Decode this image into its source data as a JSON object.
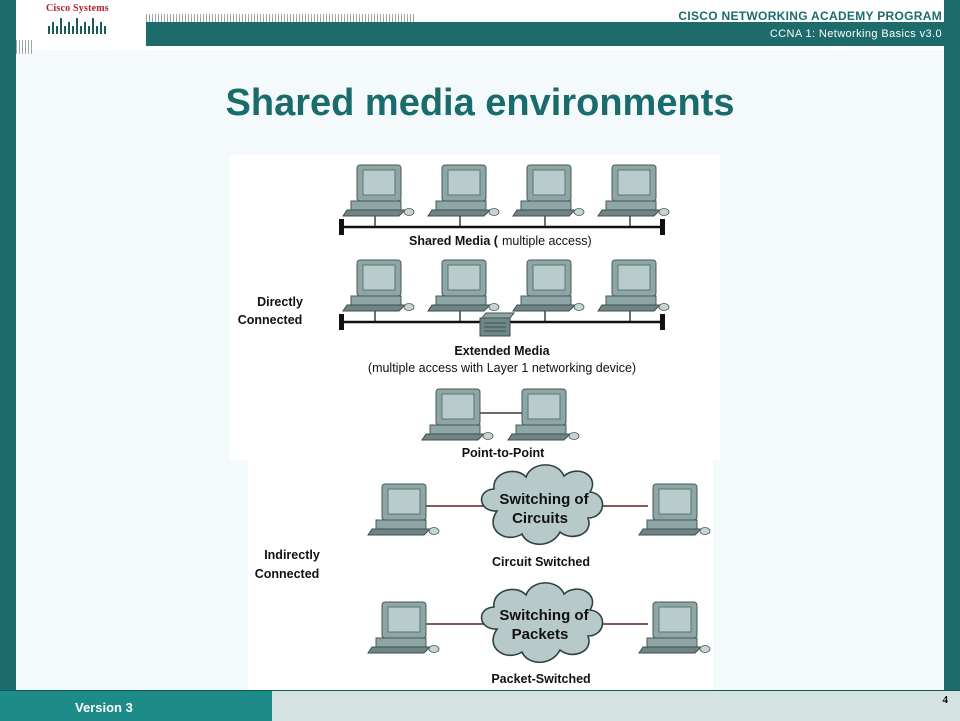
{
  "header": {
    "logo_text": "Cisco Systems",
    "program": "CISCO NETWORKING ACADEMY PROGRAM",
    "course": "CCNA 1: Networking Basics v3.0"
  },
  "slide": {
    "title": "Shared media environments"
  },
  "diagram": {
    "groups": {
      "direct": [
        "Directly",
        "Connected"
      ],
      "indirect": [
        "Indirectly",
        "Connected"
      ]
    },
    "shared_media": {
      "label_bold": "Shared Media (",
      "label_rest": "multiple access)"
    },
    "extended_media": {
      "label": "Extended Media",
      "sublabel": "(multiple access with Layer 1 networking device)"
    },
    "point_to_point": {
      "label": "Point-to-Point"
    },
    "circuit_switched": {
      "cloud": [
        "Switching of",
        "Circuits"
      ],
      "label": "Circuit Switched"
    },
    "packet_switched": {
      "cloud": [
        "Switching of",
        "Packets"
      ],
      "label": "Packet-Switched"
    }
  },
  "footer": {
    "version": "Version 3",
    "page": "4"
  },
  "colors": {
    "brand": "#1d6b6b",
    "title": "#1a6b6b",
    "footer_accent": "#1d8b88",
    "logo_red": "#b0202a"
  }
}
